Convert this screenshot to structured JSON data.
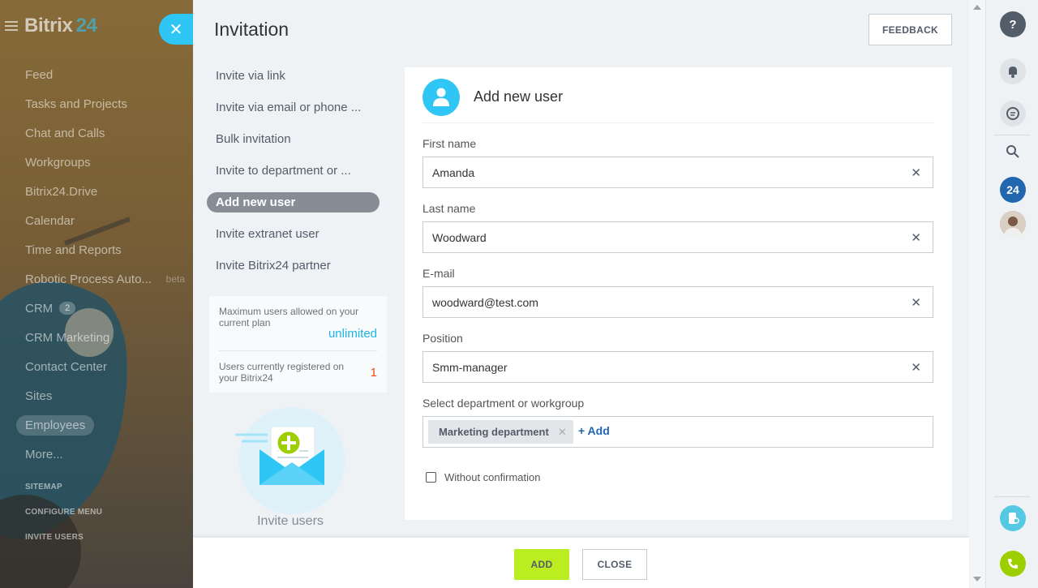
{
  "sidebar": {
    "logo": "Bitrix",
    "logo_num": "24",
    "items": [
      {
        "label": "Feed"
      },
      {
        "label": "Tasks and Projects"
      },
      {
        "label": "Chat and Calls"
      },
      {
        "label": "Workgroups"
      },
      {
        "label": "Bitrix24.Drive"
      },
      {
        "label": "Calendar"
      },
      {
        "label": "Time and Reports"
      },
      {
        "label": "Robotic Process Auto...",
        "badge": "beta"
      },
      {
        "label": "CRM",
        "counter": "2"
      },
      {
        "label": "CRM Marketing"
      },
      {
        "label": "Contact Center"
      },
      {
        "label": "Sites"
      },
      {
        "label": "Employees"
      },
      {
        "label": "More..."
      }
    ],
    "bottom": {
      "sitemap": "SITEMAP",
      "configure": "CONFIGURE MENU",
      "invite": "INVITE USERS"
    }
  },
  "panel": {
    "title": "Invitation",
    "feedback_label": "FEEDBACK",
    "nav": [
      "Invite via link",
      "Invite via email or phone ...",
      "Bulk invitation",
      "Invite to department or ...",
      "Add new user",
      "Invite extranet user",
      "Invite Bitrix24 partner"
    ],
    "plan": {
      "max_label": "Maximum users allowed on your current plan",
      "max_value": "unlimited",
      "reg_label": "Users currently registered on your Bitrix24",
      "reg_value": "1"
    },
    "illustration_label": "Invite users"
  },
  "form": {
    "title": "Add new user",
    "first_name": {
      "label": "First name",
      "value": "Amanda"
    },
    "last_name": {
      "label": "Last name",
      "value": "Woodward"
    },
    "email": {
      "label": "E-mail",
      "value": "woodward@test.com"
    },
    "position": {
      "label": "Position",
      "value": "Smm-manager"
    },
    "department": {
      "label": "Select department or workgroup",
      "tag": "Marketing department",
      "add_label": "+ Add"
    },
    "without_confirmation": "Without confirmation"
  },
  "footer": {
    "add_label": "ADD",
    "close_label": "CLOSE"
  },
  "rail": {
    "badge_24": "24"
  },
  "colors": {
    "accent": "#2fc6f6",
    "add_button": "#bbed21",
    "link": "#2067b0",
    "unlimited": "#1bb5e3",
    "count": "#f54819"
  }
}
